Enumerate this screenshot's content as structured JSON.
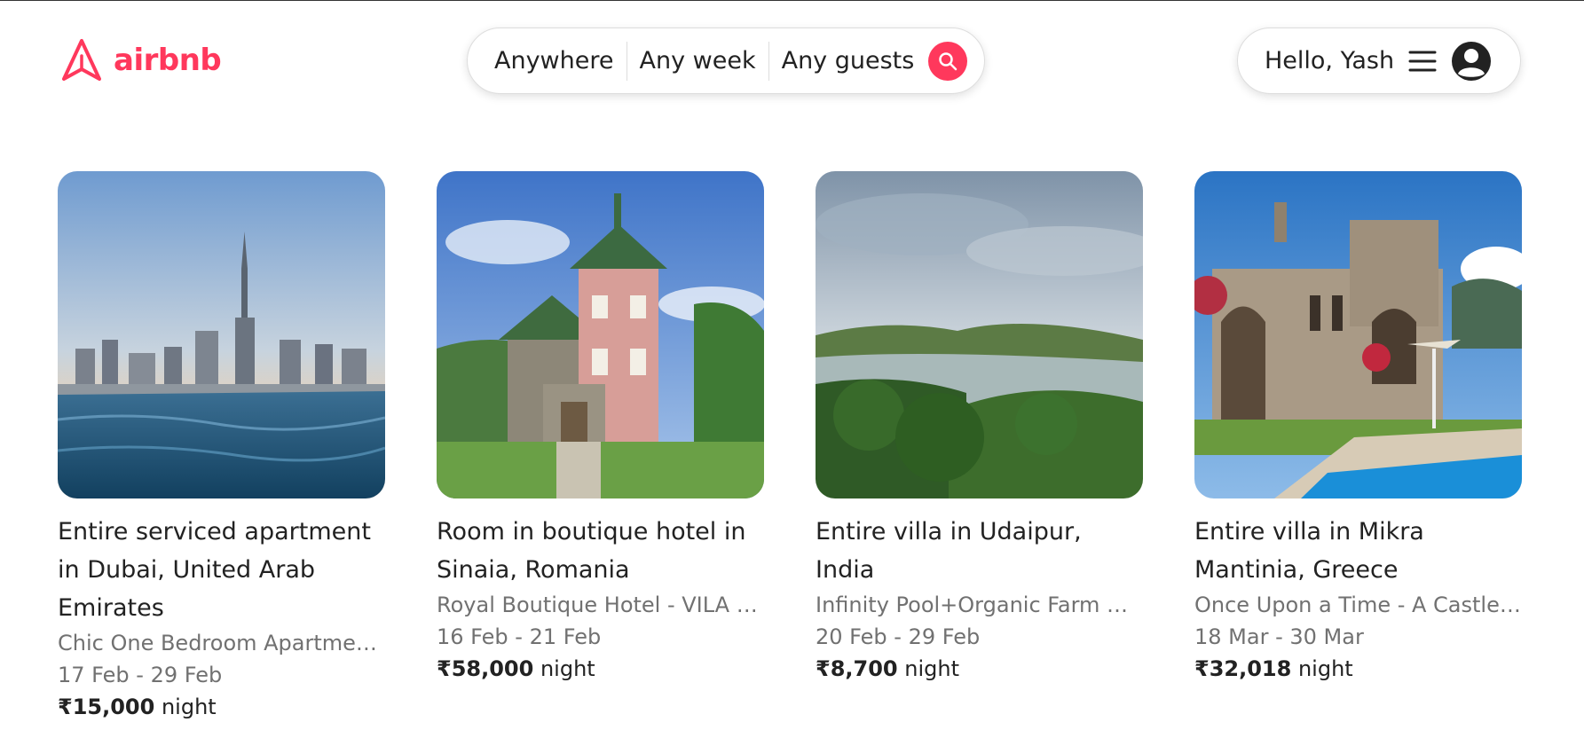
{
  "header": {
    "logo_text": "airbnb",
    "brand_color": "#ff385c",
    "search": {
      "location": "Anywhere",
      "week": "Any week",
      "guests": "Any guests",
      "icon": "search-icon"
    },
    "user": {
      "greeting": "Hello, Yash",
      "menu_icon": "hamburger-menu-icon",
      "avatar_icon": "user-avatar-icon"
    }
  },
  "listings": [
    {
      "title": "Entire serviced apartment in Dubai, United Arab Emirates",
      "subtitle": "Chic One Bedroom Apartment…",
      "dates": "17 Feb - 29 Feb",
      "price": "₹15,000",
      "price_unit": "night"
    },
    {
      "title": "Room in boutique hotel in Sinaia, Romania",
      "subtitle": "Royal Boutique Hotel - VILA D…",
      "dates": "16 Feb - 21 Feb",
      "price": "₹58,000",
      "price_unit": "night"
    },
    {
      "title": "Entire villa in Udaipur, India",
      "subtitle": "Infinity Pool+Organic Farm Ho…",
      "dates": "20 Feb - 29 Feb",
      "price": "₹8,700",
      "price_unit": "night"
    },
    {
      "title": "Entire villa in Mikra Mantinia, Greece",
      "subtitle": "Once Upon a Time - A Castle …",
      "dates": "18 Mar - 30 Mar",
      "price": "₹32,018",
      "price_unit": "night"
    }
  ]
}
